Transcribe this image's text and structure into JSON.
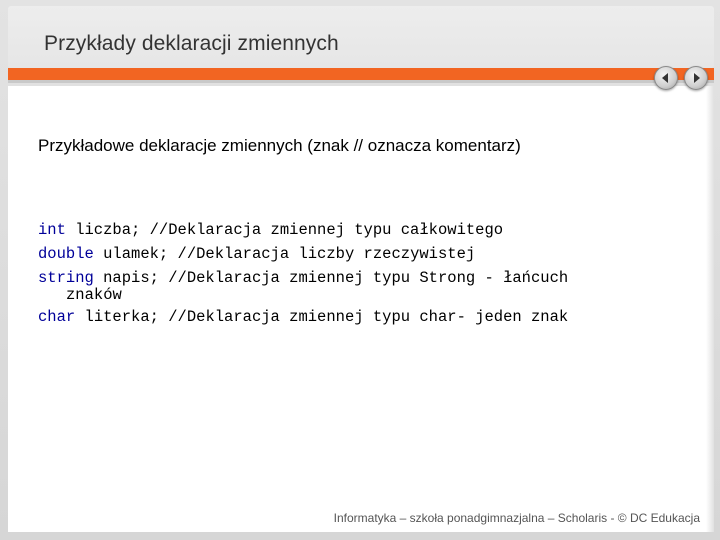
{
  "slide": {
    "title": "Przykłady deklaracji zmiennych",
    "intro": "Przykładowe deklaracje zmiennych (znak // oznacza komentarz)",
    "footer": "Informatyka – szkoła ponadgimnazjalna – Scholaris - © DC Edukacja",
    "accent_color": "#f26522"
  },
  "nav": {
    "prev_icon": "arrow-left-icon",
    "next_icon": "arrow-right-icon"
  },
  "code": {
    "line1": {
      "keyword": "int",
      "rest": " liczba; //Deklaracja zmiennej typu całkowitego"
    },
    "line2": {
      "keyword": "double",
      "rest": " ulamek; //Deklaracja liczby rzeczywistej"
    },
    "line3": {
      "keyword": "string",
      "rest": " napis; //Deklaracja zmiennej typu Strong - łańcuch"
    },
    "line3_cont": "znaków",
    "line4": {
      "keyword": "char",
      "rest": " literka; //Deklaracja zmiennej typu char- jeden znak"
    },
    "keyword_color": "#000099"
  }
}
